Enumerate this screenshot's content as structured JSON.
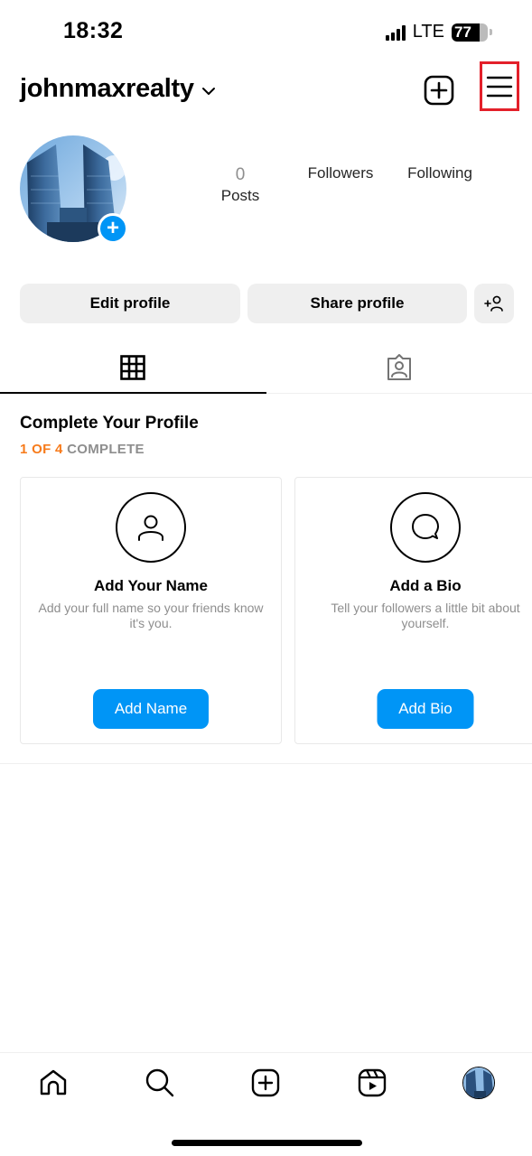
{
  "status_bar": {
    "time": "18:32",
    "network": "LTE",
    "battery_level": "77",
    "battery_fraction": 0.77
  },
  "header": {
    "username": "johnmaxrealty",
    "icons": [
      "chevron-down-icon",
      "new-post-icon",
      "menu-icon"
    ]
  },
  "profile": {
    "stats": {
      "posts_count": "0",
      "posts_label": "Posts",
      "followers_label": "Followers",
      "following_label": "Following"
    },
    "buttons": {
      "edit": "Edit profile",
      "share": "Share profile"
    }
  },
  "tabs": [
    {
      "name": "grid",
      "icon": "grid-icon",
      "active": true
    },
    {
      "name": "tagged",
      "icon": "tagged-icon",
      "active": false
    }
  ],
  "complete_profile": {
    "title": "Complete Your Profile",
    "progress_done": "1 OF 4",
    "progress_label": "COMPLETE",
    "accent_color": "#f77b1b",
    "cards": [
      {
        "icon": "person-icon",
        "title": "Add Your Name",
        "description": "Add your full name so your friends know it's you.",
        "button": "Add Name"
      },
      {
        "icon": "speech-bubble-icon",
        "title": "Add a Bio",
        "description": "Tell your followers a little bit about yourself.",
        "button": "Add Bio"
      }
    ]
  },
  "bottom_nav": {
    "items": [
      "home-icon",
      "search-icon",
      "create-icon",
      "reels-icon",
      "profile-avatar"
    ]
  },
  "colors": {
    "primary_blue": "#0095f6",
    "highlight_box": "#e3202a"
  }
}
